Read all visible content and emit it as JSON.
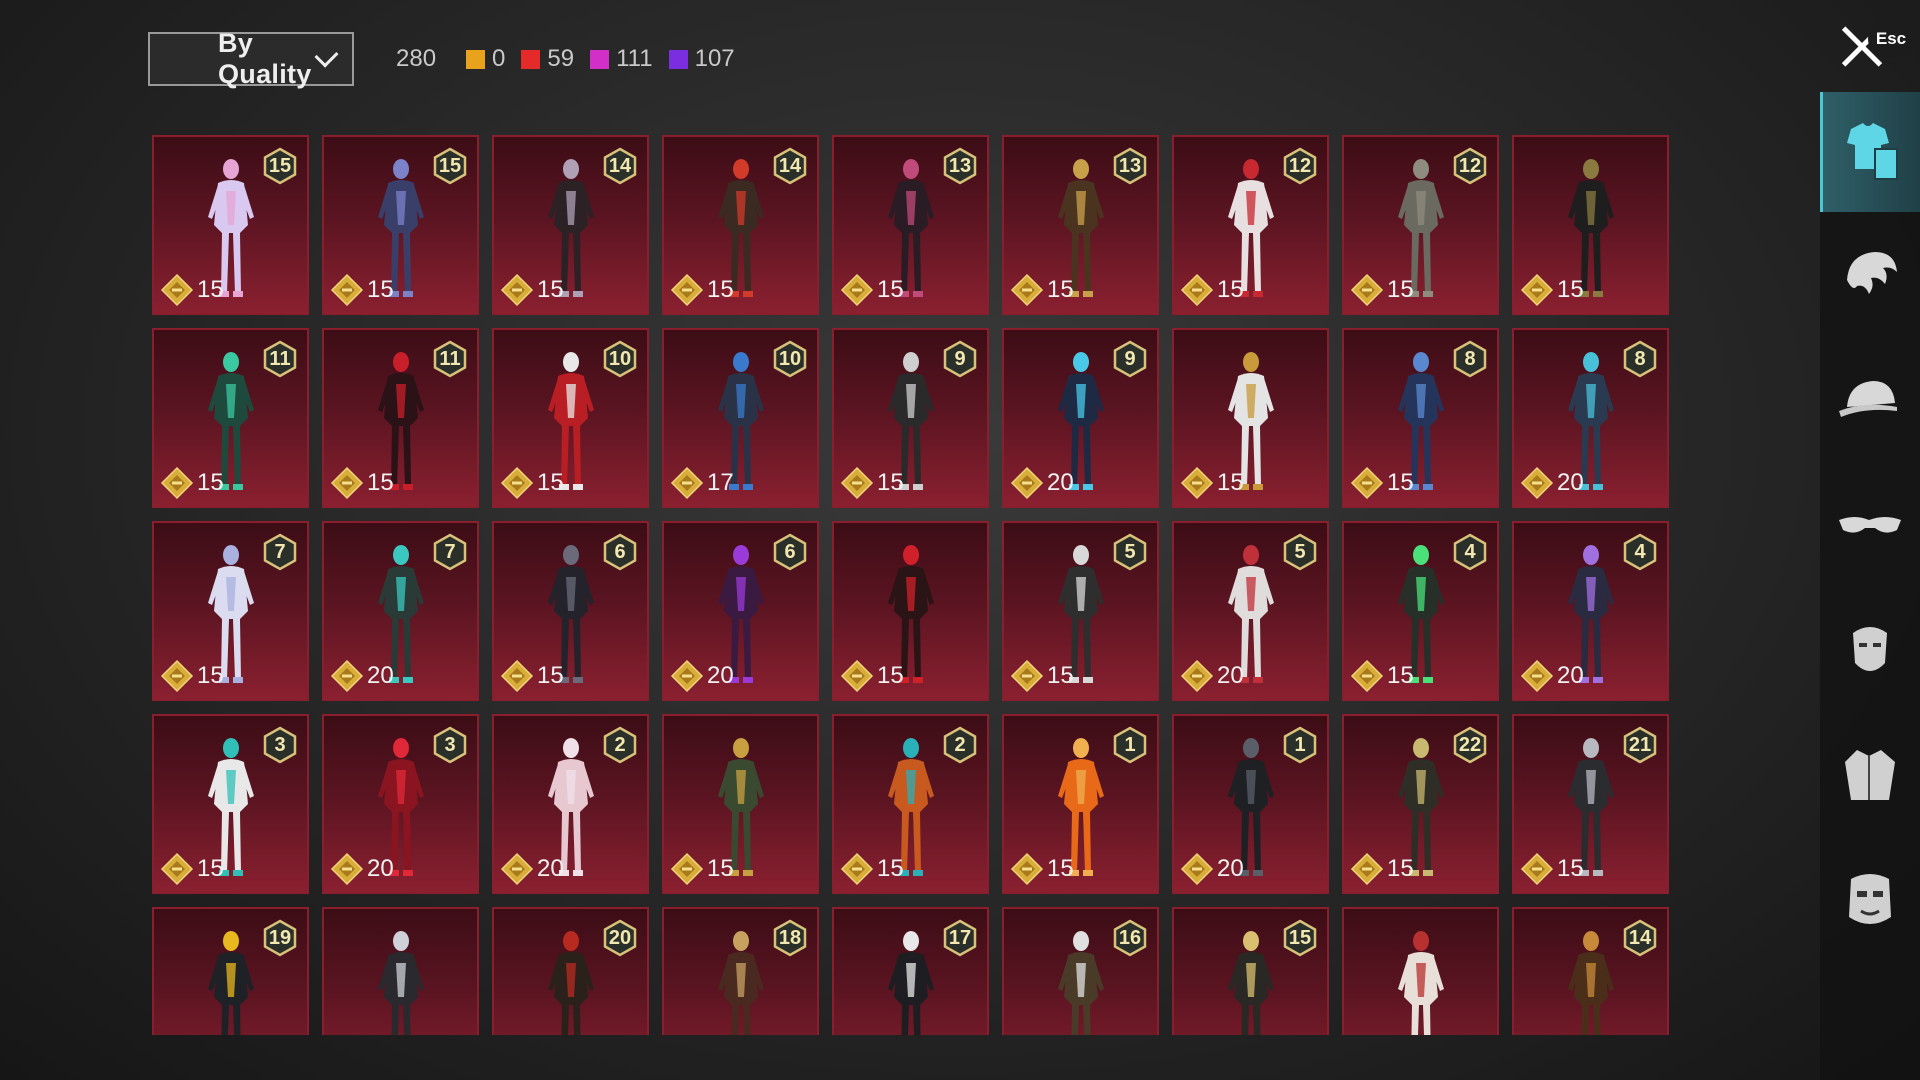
{
  "header": {
    "sort_label": "By Quality",
    "total_count": "280",
    "quality_stats": [
      {
        "color": "#e9a21b",
        "count": "0"
      },
      {
        "color": "#e52a2a",
        "count": "59"
      },
      {
        "color": "#d22fc8",
        "count": "111"
      },
      {
        "color": "#7a2ee0",
        "count": "107"
      }
    ],
    "close_hint": "Esc"
  },
  "items": [
    {
      "level": "15",
      "cost": "15",
      "suit": "#d9c8f0",
      "accent": "#e6a4d4"
    },
    {
      "level": "15",
      "cost": "15",
      "suit": "#3a3f6a",
      "accent": "#7b82c9"
    },
    {
      "level": "14",
      "cost": "15",
      "suit": "#2c2226",
      "accent": "#b0a0b6"
    },
    {
      "level": "14",
      "cost": "15",
      "suit": "#3a2a22",
      "accent": "#d23a2a"
    },
    {
      "level": "13",
      "cost": "15",
      "suit": "#2a1c24",
      "accent": "#c04a7a"
    },
    {
      "level": "13",
      "cost": "15",
      "suit": "#4a3420",
      "accent": "#c9a04a"
    },
    {
      "level": "12",
      "cost": "15",
      "suit": "#e8e0e0",
      "accent": "#c82830"
    },
    {
      "level": "12",
      "cost": "15",
      "suit": "#6a6a60",
      "accent": "#8e8c7e"
    },
    {
      "level": "",
      "cost": "15",
      "suit": "#1e1e1e",
      "accent": "#8a7a40"
    },
    {
      "level": "11",
      "cost": "15",
      "suit": "#1e4a3e",
      "accent": "#3ac8a0"
    },
    {
      "level": "11",
      "cost": "15",
      "suit": "#2a1216",
      "accent": "#c81f2a"
    },
    {
      "level": "10",
      "cost": "15",
      "suit": "#b81e24",
      "accent": "#e8e8e8"
    },
    {
      "level": "10",
      "cost": "17",
      "suit": "#2a3248",
      "accent": "#3a7acc"
    },
    {
      "level": "9",
      "cost": "15",
      "suit": "#2a2a2a",
      "accent": "#cfcfcf"
    },
    {
      "level": "9",
      "cost": "20",
      "suit": "#1e2a44",
      "accent": "#4ac8e8"
    },
    {
      "level": "",
      "cost": "15",
      "suit": "#e4e4e4",
      "accent": "#c89a3a"
    },
    {
      "level": "8",
      "cost": "15",
      "suit": "#24345a",
      "accent": "#5a88d0"
    },
    {
      "level": "8",
      "cost": "20",
      "suit": "#2a3a50",
      "accent": "#48c0d8"
    },
    {
      "level": "7",
      "cost": "15",
      "suit": "#dcdcf0",
      "accent": "#aab0e0"
    },
    {
      "level": "7",
      "cost": "20",
      "suit": "#2a3a36",
      "accent": "#3ac8c0"
    },
    {
      "level": "6",
      "cost": "15",
      "suit": "#24222a",
      "accent": "#6a6a7a"
    },
    {
      "level": "6",
      "cost": "20",
      "suit": "#3a1a40",
      "accent": "#9a3ad8"
    },
    {
      "level": "",
      "cost": "15",
      "suit": "#2a1416",
      "accent": "#d0202a"
    },
    {
      "level": "5",
      "cost": "15",
      "suit": "#2e2e2e",
      "accent": "#d8d8d8"
    },
    {
      "level": "5",
      "cost": "20",
      "suit": "#e0dcdc",
      "accent": "#c0303a"
    },
    {
      "level": "4",
      "cost": "15",
      "suit": "#263028",
      "accent": "#4ae07a"
    },
    {
      "level": "4",
      "cost": "20",
      "suit": "#2a2a40",
      "accent": "#a070e0"
    },
    {
      "level": "3",
      "cost": "15",
      "suit": "#e8e8e8",
      "accent": "#30c0b8"
    },
    {
      "level": "3",
      "cost": "20",
      "suit": "#8a1420",
      "accent": "#e02838"
    },
    {
      "level": "2",
      "cost": "20",
      "suit": "#e8c8d0",
      "accent": "#f0e0e8"
    },
    {
      "level": "",
      "cost": "15",
      "suit": "#3a4a30",
      "accent": "#c8a040"
    },
    {
      "level": "2",
      "cost": "15",
      "suit": "#c85a20",
      "accent": "#2ab0b8"
    },
    {
      "level": "1",
      "cost": "15",
      "suit": "#e86a18",
      "accent": "#f0b050"
    },
    {
      "level": "1",
      "cost": "20",
      "suit": "#1e2024",
      "accent": "#5a5e68"
    },
    {
      "level": "22",
      "cost": "15",
      "suit": "#2e2e26",
      "accent": "#c8b870"
    },
    {
      "level": "21",
      "cost": "15",
      "suit": "#2a2c30",
      "accent": "#b8b8c0"
    },
    {
      "level": "19",
      "cost": "",
      "suit": "#1e2226",
      "accent": "#e8b81e"
    },
    {
      "level": "",
      "cost": "",
      "suit": "#2a2a2e",
      "accent": "#d0d0d8"
    },
    {
      "level": "20",
      "cost": "",
      "suit": "#2a221a",
      "accent": "#b82a20"
    },
    {
      "level": "18",
      "cost": "",
      "suit": "#4a2a20",
      "accent": "#c8a060"
    },
    {
      "level": "17",
      "cost": "",
      "suit": "#1e1e22",
      "accent": "#e8e8e8"
    },
    {
      "level": "16",
      "cost": "",
      "suit": "#4a3a28",
      "accent": "#e0e0e0"
    },
    {
      "level": "15",
      "cost": "",
      "suit": "#2a2824",
      "accent": "#d8c070"
    },
    {
      "level": "",
      "cost": "",
      "suit": "#e8e0d8",
      "accent": "#b83030"
    },
    {
      "level": "14",
      "cost": "",
      "suit": "#4a2e1a",
      "accent": "#c88a3a"
    }
  ],
  "sidebar": [
    {
      "icon": "outfit-icon",
      "active": true
    },
    {
      "icon": "hair-icon",
      "active": false
    },
    {
      "icon": "hat-icon",
      "active": false
    },
    {
      "icon": "glasses-icon",
      "active": false
    },
    {
      "icon": "mask-icon",
      "active": false
    },
    {
      "icon": "jacket-icon",
      "active": false
    },
    {
      "icon": "face-icon",
      "active": false
    }
  ]
}
